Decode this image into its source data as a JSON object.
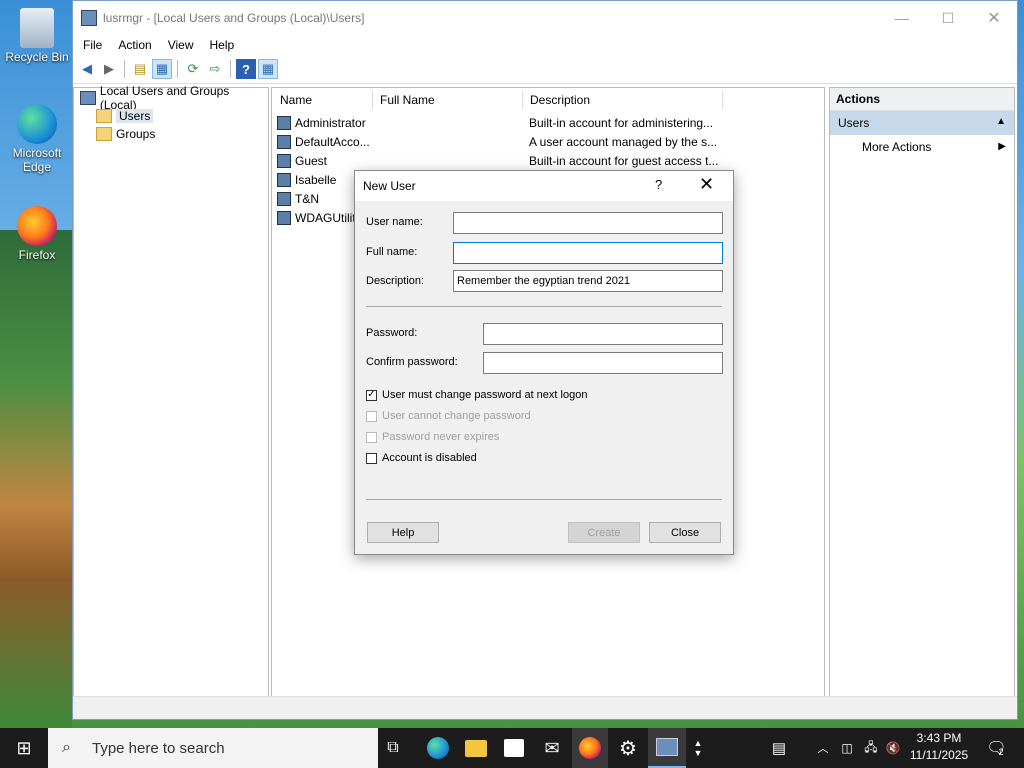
{
  "desktop": {
    "icons": [
      {
        "label": "Recycle Bin"
      },
      {
        "label": "Microsoft Edge"
      },
      {
        "label": "Firefox"
      }
    ]
  },
  "window": {
    "title": "lusrmgr - [Local Users and Groups (Local)\\Users]",
    "controls": {
      "minimize": "—",
      "maximize": "☐",
      "close": "✕"
    }
  },
  "menu": [
    "File",
    "Action",
    "View",
    "Help"
  ],
  "tree": {
    "root": "Local Users and Groups (Local)",
    "items": [
      "Users",
      "Groups"
    ]
  },
  "list": {
    "columns": [
      "Name",
      "Full Name",
      "Description"
    ],
    "rows": [
      {
        "name": "Administrator",
        "full_name": "",
        "description": "Built-in account for administering..."
      },
      {
        "name": "DefaultAcco...",
        "full_name": "",
        "description": "A user account managed by the s..."
      },
      {
        "name": "Guest",
        "full_name": "",
        "description": "Built-in account for guest access t..."
      },
      {
        "name": "Isabelle",
        "full_name": "",
        "description": ""
      },
      {
        "name": "T&N",
        "full_name": "",
        "description": ""
      },
      {
        "name": "WDAGUtilit",
        "full_name": "",
        "description": ""
      }
    ]
  },
  "actions": {
    "header": "Actions",
    "group": "Users",
    "items": [
      "More Actions"
    ]
  },
  "dialog": {
    "title": "New User",
    "help_glyph": "?",
    "close_glyph": "✕",
    "fields": {
      "username": {
        "label": "User name:",
        "value": ""
      },
      "fullname": {
        "label": "Full name:",
        "value": ""
      },
      "description": {
        "label": "Description:",
        "value": "Remember the egyptian trend 2021"
      },
      "password": {
        "label": "Password:",
        "value": ""
      },
      "confirm": {
        "label": "Confirm password:",
        "value": ""
      }
    },
    "checkboxes": {
      "must_change": {
        "label": "User must change password at next logon",
        "checked": true,
        "enabled": true
      },
      "cannot_change": {
        "label": "User cannot change password",
        "checked": false,
        "enabled": false
      },
      "never_expires": {
        "label": "Password never expires",
        "checked": false,
        "enabled": false
      },
      "disabled": {
        "label": "Account is disabled",
        "checked": false,
        "enabled": true
      }
    },
    "buttons": {
      "help": "Help",
      "create": "Create",
      "close": "Close"
    }
  },
  "taskbar": {
    "search_placeholder": "Type here to search",
    "time": "3:43 PM",
    "date": "11/11/2025",
    "notification_count": "2"
  },
  "colors": {
    "accent": "#0078d7",
    "selection": "#c6d8ea",
    "taskbar": "#1c1c1c"
  }
}
